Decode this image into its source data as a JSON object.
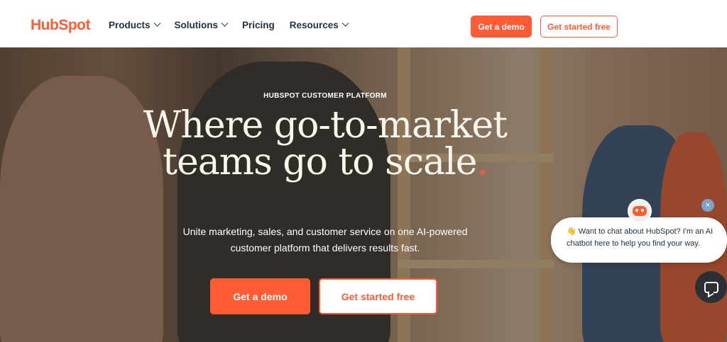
{
  "nav": {
    "logo": "HubSpot",
    "items": [
      {
        "label": "Products",
        "dropdown": true
      },
      {
        "label": "Solutions",
        "dropdown": true
      },
      {
        "label": "Pricing",
        "dropdown": false
      },
      {
        "label": "Resources",
        "dropdown": true
      }
    ],
    "demo_label": "Get a demo",
    "free_label": "Get started free"
  },
  "hero": {
    "eyebrow": "HUBSPOT CUSTOMER PLATFORM",
    "headline_line1": "Where go-to-market",
    "headline_line2": "teams go to scale",
    "headline_accent": ".",
    "subtitle_line1": "Unite marketing, sales, and customer service on one AI-powered",
    "subtitle_line2": "customer platform that delivers results fast.",
    "demo_label": "Get a demo",
    "free_label": "Get started free"
  },
  "chat": {
    "emoji": "👋",
    "message": "Want to chat about HubSpot? I'm an AI chatbot here to help you find your way.",
    "close": "×"
  },
  "colors": {
    "brand": "#ff5c35",
    "text_dark": "#213343"
  }
}
